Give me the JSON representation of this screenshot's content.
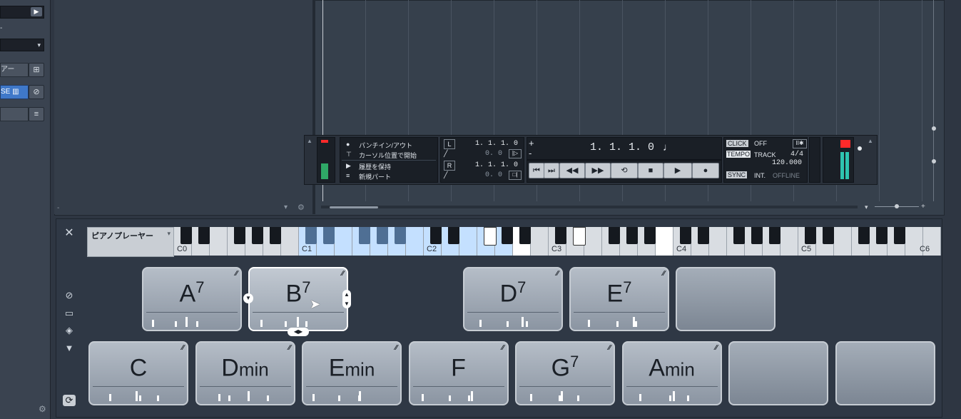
{
  "left_panel": {
    "field1": "",
    "field2": "",
    "row1_label": "アー",
    "row2_label": "SE",
    "row3_label": ""
  },
  "transport": {
    "punch_in_out": "パンチイン/アウト",
    "start_at_cursor": "カーソル位置で開始",
    "keep_history": "履歴を保持",
    "new_part": "新規パート",
    "left_locator": "1. 1. 1. 0",
    "left_offset": "0. 0",
    "right_locator": "1. 1. 1. 0",
    "right_offset": "0. 0",
    "position": "1. 1. 1. 0",
    "click_label": "CLICK",
    "click_value": "OFF",
    "tempo_label": "TEMPO",
    "tempo_mode": "TRACK",
    "signature": "4/4",
    "tempo_value": "120.000",
    "sync_label": "SYNC",
    "sync_mode": "INT.",
    "sync_status": "OFFLINE",
    "L": "L",
    "R": "R"
  },
  "chord_pads": {
    "preset": "ピアノプレーヤー",
    "octave_labels": [
      "C0",
      "C1",
      "C2",
      "C3",
      "C4",
      "C5",
      "C6"
    ],
    "top_row": [
      {
        "root": "A",
        "ext": "7",
        "suffix": ""
      },
      {
        "root": "B",
        "ext": "7",
        "suffix": ""
      },
      {
        "root": "",
        "ext": "",
        "suffix": ""
      },
      {
        "root": "D",
        "ext": "7",
        "suffix": ""
      },
      {
        "root": "E",
        "ext": "7",
        "suffix": ""
      },
      {
        "root": "",
        "ext": "",
        "suffix": ""
      }
    ],
    "bottom_row": [
      {
        "root": "C",
        "ext": "",
        "suffix": ""
      },
      {
        "root": "D",
        "ext": "",
        "suffix": "min"
      },
      {
        "root": "E",
        "ext": "",
        "suffix": "min"
      },
      {
        "root": "F",
        "ext": "",
        "suffix": ""
      },
      {
        "root": "G",
        "ext": "7",
        "suffix": ""
      },
      {
        "root": "A",
        "ext": "",
        "suffix": "min"
      },
      {
        "root": "",
        "ext": "",
        "suffix": ""
      },
      {
        "root": "",
        "ext": "",
        "suffix": ""
      }
    ]
  },
  "colors": {
    "accent_blue": "#4f6f94",
    "record_red": "#ff2a2a",
    "meter_green": "#2ec4b0"
  }
}
